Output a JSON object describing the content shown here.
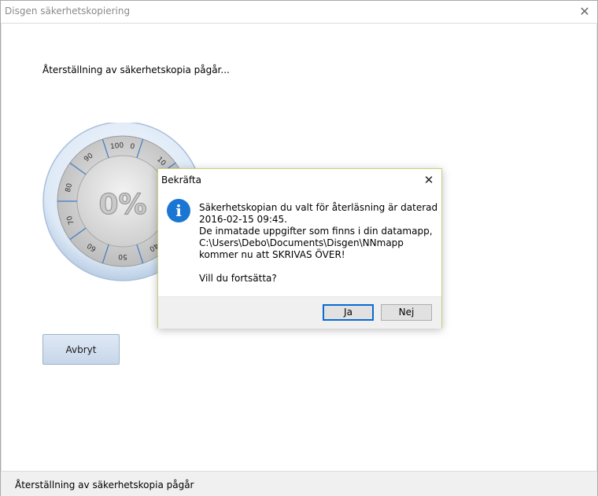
{
  "window": {
    "title": "Disgen säkerhetskopiering"
  },
  "main": {
    "progress_text": "Återställning av säkerhetskopia pågår...",
    "progress_percent_label": "0%",
    "progress_percent": 0,
    "dial_ticks": [
      "100",
      "0",
      "10",
      "90",
      "80",
      "70",
      "60",
      "50",
      "40"
    ],
    "cancel_label": "Avbryt"
  },
  "status": {
    "text": "Återställning av säkerhetskopia pågår"
  },
  "dialog": {
    "title": "Bekräfta",
    "icon": "info-icon",
    "lines": [
      "Säkerhetskopian du valt för återläsning är daterad",
      "2016-02-15 09:45.",
      "De inmatade uppgifter som finns i din datamapp,",
      "C:\\Users\\Debo\\Documents\\Disgen\\NNmapp",
      "kommer nu att SKRIVAS ÖVER!"
    ],
    "question": "Vill du fortsätta?",
    "yes_label": "Ja",
    "no_label": "Nej"
  },
  "colors": {
    "accent": "#0a6bd1",
    "info_icon": "#1a76d2",
    "dialog_border": "#c9d07a"
  }
}
